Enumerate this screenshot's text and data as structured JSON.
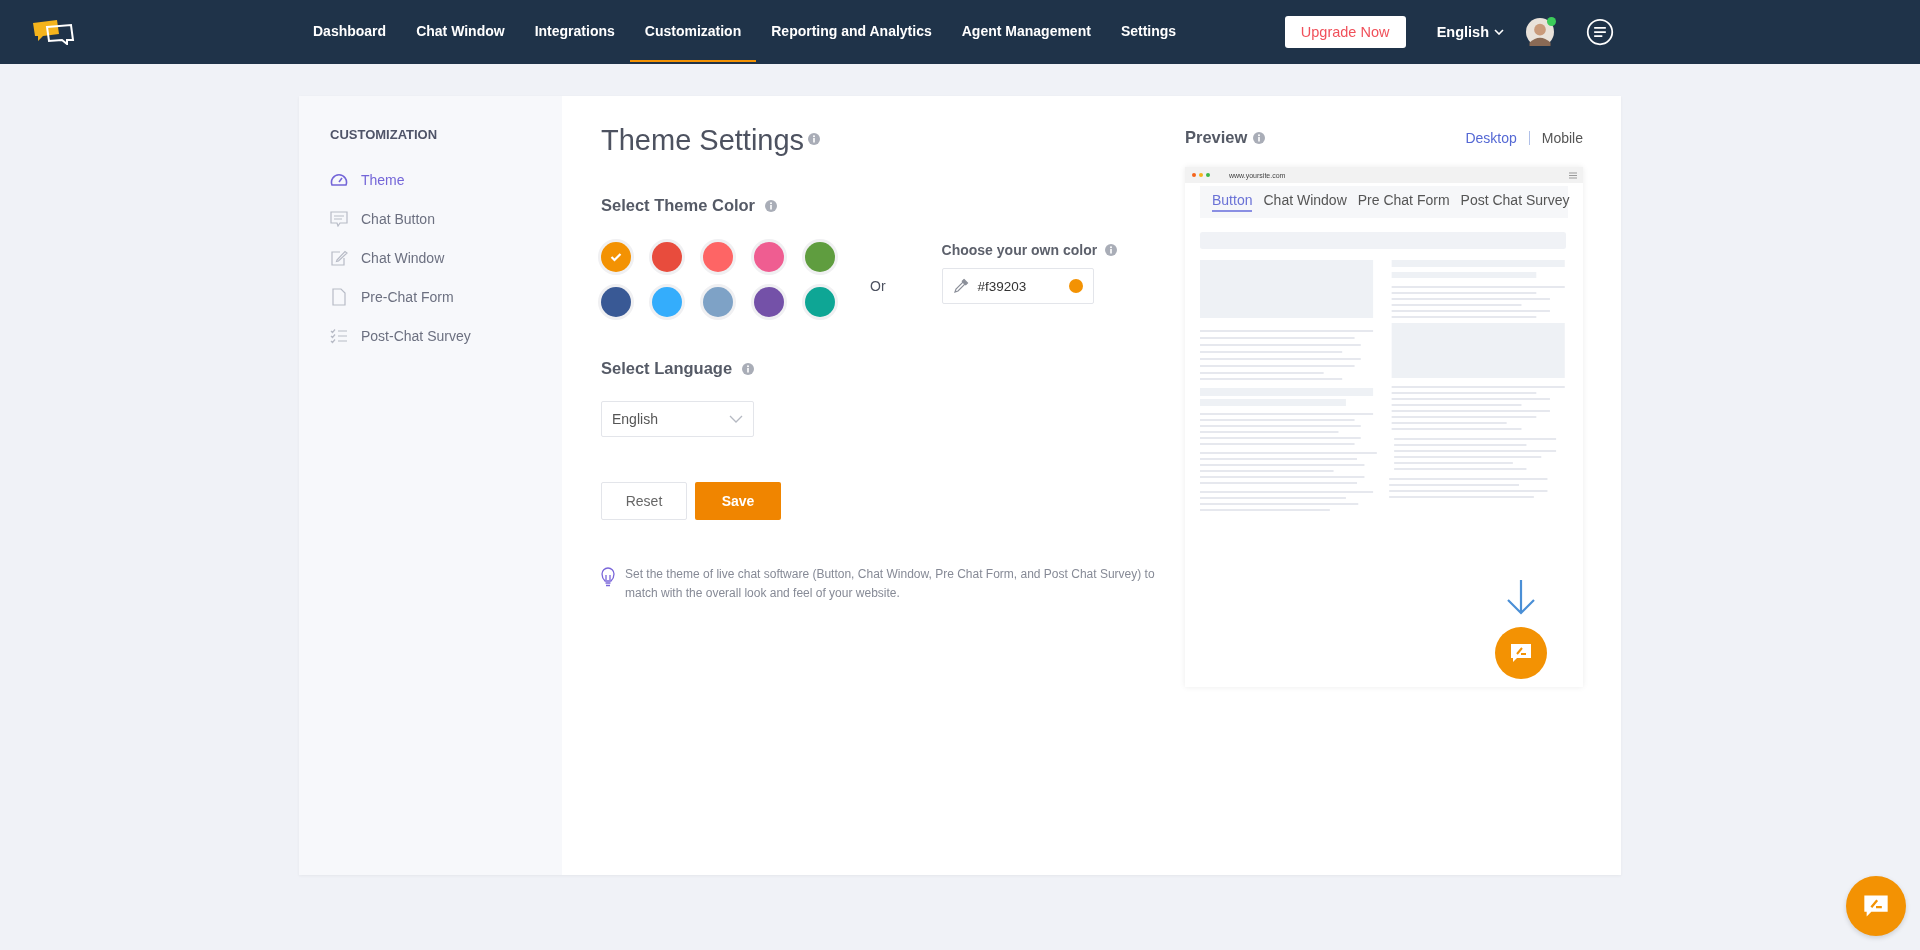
{
  "nav": {
    "items": [
      {
        "label": "Dashboard",
        "selected": false
      },
      {
        "label": "Chat Window",
        "selected": false
      },
      {
        "label": "Integrations",
        "selected": false
      },
      {
        "label": "Customization",
        "selected": true
      },
      {
        "label": "Reporting and Analytics",
        "selected": false
      },
      {
        "label": "Agent Management",
        "selected": false
      },
      {
        "label": "Settings",
        "selected": false
      }
    ],
    "upgrade_button": "Upgrade Now",
    "language": "English",
    "user_online": true
  },
  "sidebar": {
    "heading": "CUSTOMIZATION",
    "items": [
      {
        "label": "Theme",
        "selected": true
      },
      {
        "label": "Chat Button",
        "selected": false
      },
      {
        "label": "Chat Window",
        "selected": false
      },
      {
        "label": "Pre-Chat Form",
        "selected": false
      },
      {
        "label": "Post-Chat Survey",
        "selected": false
      }
    ]
  },
  "main": {
    "title": "Theme Settings",
    "theme_color": {
      "label": "Select Theme Color",
      "swatches": [
        {
          "color": "#f39203",
          "selected": true
        },
        {
          "color": "#e84c3d",
          "selected": false
        },
        {
          "color": "#fe6565",
          "selected": false
        },
        {
          "color": "#ef5d91",
          "selected": false
        },
        {
          "color": "#5f9d3f",
          "selected": false
        },
        {
          "color": "#395995",
          "selected": false
        },
        {
          "color": "#34adfc",
          "selected": false
        },
        {
          "color": "#7ea2c6",
          "selected": false
        },
        {
          "color": "#7451a8",
          "selected": false
        },
        {
          "color": "#0ea695",
          "selected": false
        }
      ]
    },
    "or_label": "Or",
    "custom_color": {
      "label": "Choose your own color",
      "value": "#f39203"
    },
    "language": {
      "label": "Select Language",
      "value": "English"
    },
    "buttons": {
      "reset": "Reset",
      "save": "Save"
    },
    "tip": "Set the theme of live chat software (Button, Chat Window, Pre Chat Form, and Post Chat Survey) to match with the overall look and feel of your website."
  },
  "preview": {
    "title": "Preview",
    "views": [
      {
        "label": "Desktop",
        "selected": true
      },
      {
        "label": "Mobile",
        "selected": false
      }
    ],
    "url": "www.yoursite.com",
    "tabs": [
      {
        "label": "Button",
        "selected": true
      },
      {
        "label": "Chat Window",
        "selected": false
      },
      {
        "label": "Pre Chat Form",
        "selected": false
      },
      {
        "label": "Post Chat Survey",
        "selected": false
      }
    ]
  }
}
